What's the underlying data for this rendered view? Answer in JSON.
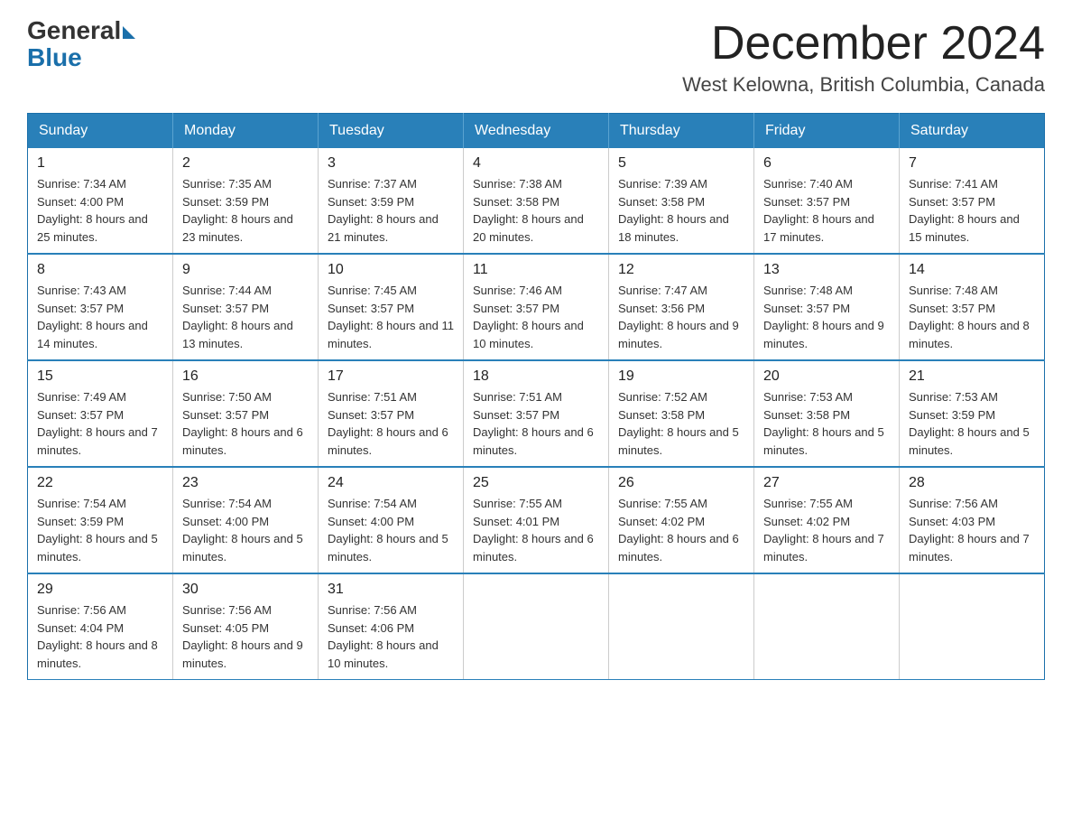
{
  "header": {
    "logo_general": "General",
    "logo_blue": "Blue",
    "month_title": "December 2024",
    "location": "West Kelowna, British Columbia, Canada"
  },
  "weekdays": [
    "Sunday",
    "Monday",
    "Tuesday",
    "Wednesday",
    "Thursday",
    "Friday",
    "Saturday"
  ],
  "weeks": [
    [
      {
        "day": "1",
        "sunrise": "7:34 AM",
        "sunset": "4:00 PM",
        "daylight": "8 hours and 25 minutes."
      },
      {
        "day": "2",
        "sunrise": "7:35 AM",
        "sunset": "3:59 PM",
        "daylight": "8 hours and 23 minutes."
      },
      {
        "day": "3",
        "sunrise": "7:37 AM",
        "sunset": "3:59 PM",
        "daylight": "8 hours and 21 minutes."
      },
      {
        "day": "4",
        "sunrise": "7:38 AM",
        "sunset": "3:58 PM",
        "daylight": "8 hours and 20 minutes."
      },
      {
        "day": "5",
        "sunrise": "7:39 AM",
        "sunset": "3:58 PM",
        "daylight": "8 hours and 18 minutes."
      },
      {
        "day": "6",
        "sunrise": "7:40 AM",
        "sunset": "3:57 PM",
        "daylight": "8 hours and 17 minutes."
      },
      {
        "day": "7",
        "sunrise": "7:41 AM",
        "sunset": "3:57 PM",
        "daylight": "8 hours and 15 minutes."
      }
    ],
    [
      {
        "day": "8",
        "sunrise": "7:43 AM",
        "sunset": "3:57 PM",
        "daylight": "8 hours and 14 minutes."
      },
      {
        "day": "9",
        "sunrise": "7:44 AM",
        "sunset": "3:57 PM",
        "daylight": "8 hours and 13 minutes."
      },
      {
        "day": "10",
        "sunrise": "7:45 AM",
        "sunset": "3:57 PM",
        "daylight": "8 hours and 11 minutes."
      },
      {
        "day": "11",
        "sunrise": "7:46 AM",
        "sunset": "3:57 PM",
        "daylight": "8 hours and 10 minutes."
      },
      {
        "day": "12",
        "sunrise": "7:47 AM",
        "sunset": "3:56 PM",
        "daylight": "8 hours and 9 minutes."
      },
      {
        "day": "13",
        "sunrise": "7:48 AM",
        "sunset": "3:57 PM",
        "daylight": "8 hours and 9 minutes."
      },
      {
        "day": "14",
        "sunrise": "7:48 AM",
        "sunset": "3:57 PM",
        "daylight": "8 hours and 8 minutes."
      }
    ],
    [
      {
        "day": "15",
        "sunrise": "7:49 AM",
        "sunset": "3:57 PM",
        "daylight": "8 hours and 7 minutes."
      },
      {
        "day": "16",
        "sunrise": "7:50 AM",
        "sunset": "3:57 PM",
        "daylight": "8 hours and 6 minutes."
      },
      {
        "day": "17",
        "sunrise": "7:51 AM",
        "sunset": "3:57 PM",
        "daylight": "8 hours and 6 minutes."
      },
      {
        "day": "18",
        "sunrise": "7:51 AM",
        "sunset": "3:57 PM",
        "daylight": "8 hours and 6 minutes."
      },
      {
        "day": "19",
        "sunrise": "7:52 AM",
        "sunset": "3:58 PM",
        "daylight": "8 hours and 5 minutes."
      },
      {
        "day": "20",
        "sunrise": "7:53 AM",
        "sunset": "3:58 PM",
        "daylight": "8 hours and 5 minutes."
      },
      {
        "day": "21",
        "sunrise": "7:53 AM",
        "sunset": "3:59 PM",
        "daylight": "8 hours and 5 minutes."
      }
    ],
    [
      {
        "day": "22",
        "sunrise": "7:54 AM",
        "sunset": "3:59 PM",
        "daylight": "8 hours and 5 minutes."
      },
      {
        "day": "23",
        "sunrise": "7:54 AM",
        "sunset": "4:00 PM",
        "daylight": "8 hours and 5 minutes."
      },
      {
        "day": "24",
        "sunrise": "7:54 AM",
        "sunset": "4:00 PM",
        "daylight": "8 hours and 5 minutes."
      },
      {
        "day": "25",
        "sunrise": "7:55 AM",
        "sunset": "4:01 PM",
        "daylight": "8 hours and 6 minutes."
      },
      {
        "day": "26",
        "sunrise": "7:55 AM",
        "sunset": "4:02 PM",
        "daylight": "8 hours and 6 minutes."
      },
      {
        "day": "27",
        "sunrise": "7:55 AM",
        "sunset": "4:02 PM",
        "daylight": "8 hours and 7 minutes."
      },
      {
        "day": "28",
        "sunrise": "7:56 AM",
        "sunset": "4:03 PM",
        "daylight": "8 hours and 7 minutes."
      }
    ],
    [
      {
        "day": "29",
        "sunrise": "7:56 AM",
        "sunset": "4:04 PM",
        "daylight": "8 hours and 8 minutes."
      },
      {
        "day": "30",
        "sunrise": "7:56 AM",
        "sunset": "4:05 PM",
        "daylight": "8 hours and 9 minutes."
      },
      {
        "day": "31",
        "sunrise": "7:56 AM",
        "sunset": "4:06 PM",
        "daylight": "8 hours and 10 minutes."
      },
      null,
      null,
      null,
      null
    ]
  ]
}
